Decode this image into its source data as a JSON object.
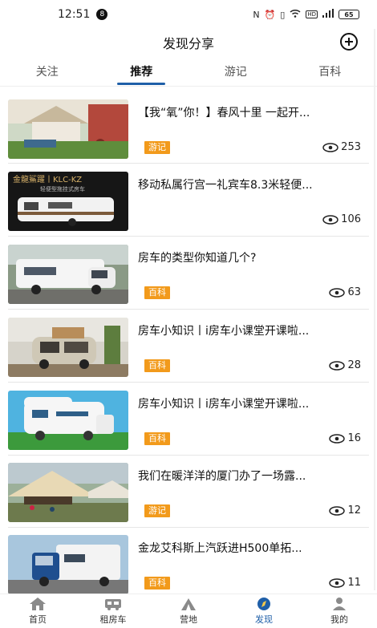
{
  "status": {
    "time": "12:51",
    "notification_count": "8",
    "battery": "65",
    "signal_icons": [
      "nfc-icon",
      "alarm-icon",
      "vibrate-icon",
      "wifi-icon",
      "hd-icon",
      "signal-icon"
    ]
  },
  "header": {
    "title": "发现分享",
    "add_icon": "plus-circle-icon"
  },
  "tabs": [
    {
      "label": "关注",
      "active": false
    },
    {
      "label": "推荐",
      "active": true
    },
    {
      "label": "游记",
      "active": false
    },
    {
      "label": "百科",
      "active": false
    }
  ],
  "articles": [
    {
      "title": "【我“氧”你！】春风十里 一起开...",
      "tag": "游记",
      "views": "253",
      "image": "garden-rv-photo"
    },
    {
      "title": "移动私属行宫一礼宾车8.3米轻便...",
      "tag": "",
      "views": "106",
      "image": "trailer-ad-photo"
    },
    {
      "title": "房车的类型你知道几个?",
      "tag": "百科",
      "views": "63",
      "image": "white-motorhome-photo"
    },
    {
      "title": "房车小知识丨i房车小课堂开课啦...",
      "tag": "百科",
      "views": "28",
      "image": "vintage-van-photo"
    },
    {
      "title": "房车小知识丨i房车小课堂开课啦...",
      "tag": "百科",
      "views": "16",
      "image": "illustrated-rv-photo"
    },
    {
      "title": "我们在暖洋洋的厦门办了一场露...",
      "tag": "游记",
      "views": "12",
      "image": "camping-tent-photo"
    },
    {
      "title": "金龙艾科斯上汽跃进H500单拓...",
      "tag": "百科",
      "views": "11",
      "image": "blue-motorhome-photo"
    }
  ],
  "thumb_text": {
    "trailer_ad_heading": "金龍鯊躍丨KLC-KZ",
    "trailer_ad_sub": "轻便型拖挂式房车"
  },
  "colors": {
    "accent": "#1f5fa8",
    "tag": "#f29a1b"
  },
  "bottom_nav": [
    {
      "label": "首页",
      "icon": "home-icon",
      "active": false
    },
    {
      "label": "租房车",
      "icon": "rv-icon",
      "active": false
    },
    {
      "label": "营地",
      "icon": "campsite-icon",
      "active": false
    },
    {
      "label": "发现",
      "icon": "discover-icon",
      "active": true
    },
    {
      "label": "我的",
      "icon": "user-icon",
      "active": false
    }
  ]
}
